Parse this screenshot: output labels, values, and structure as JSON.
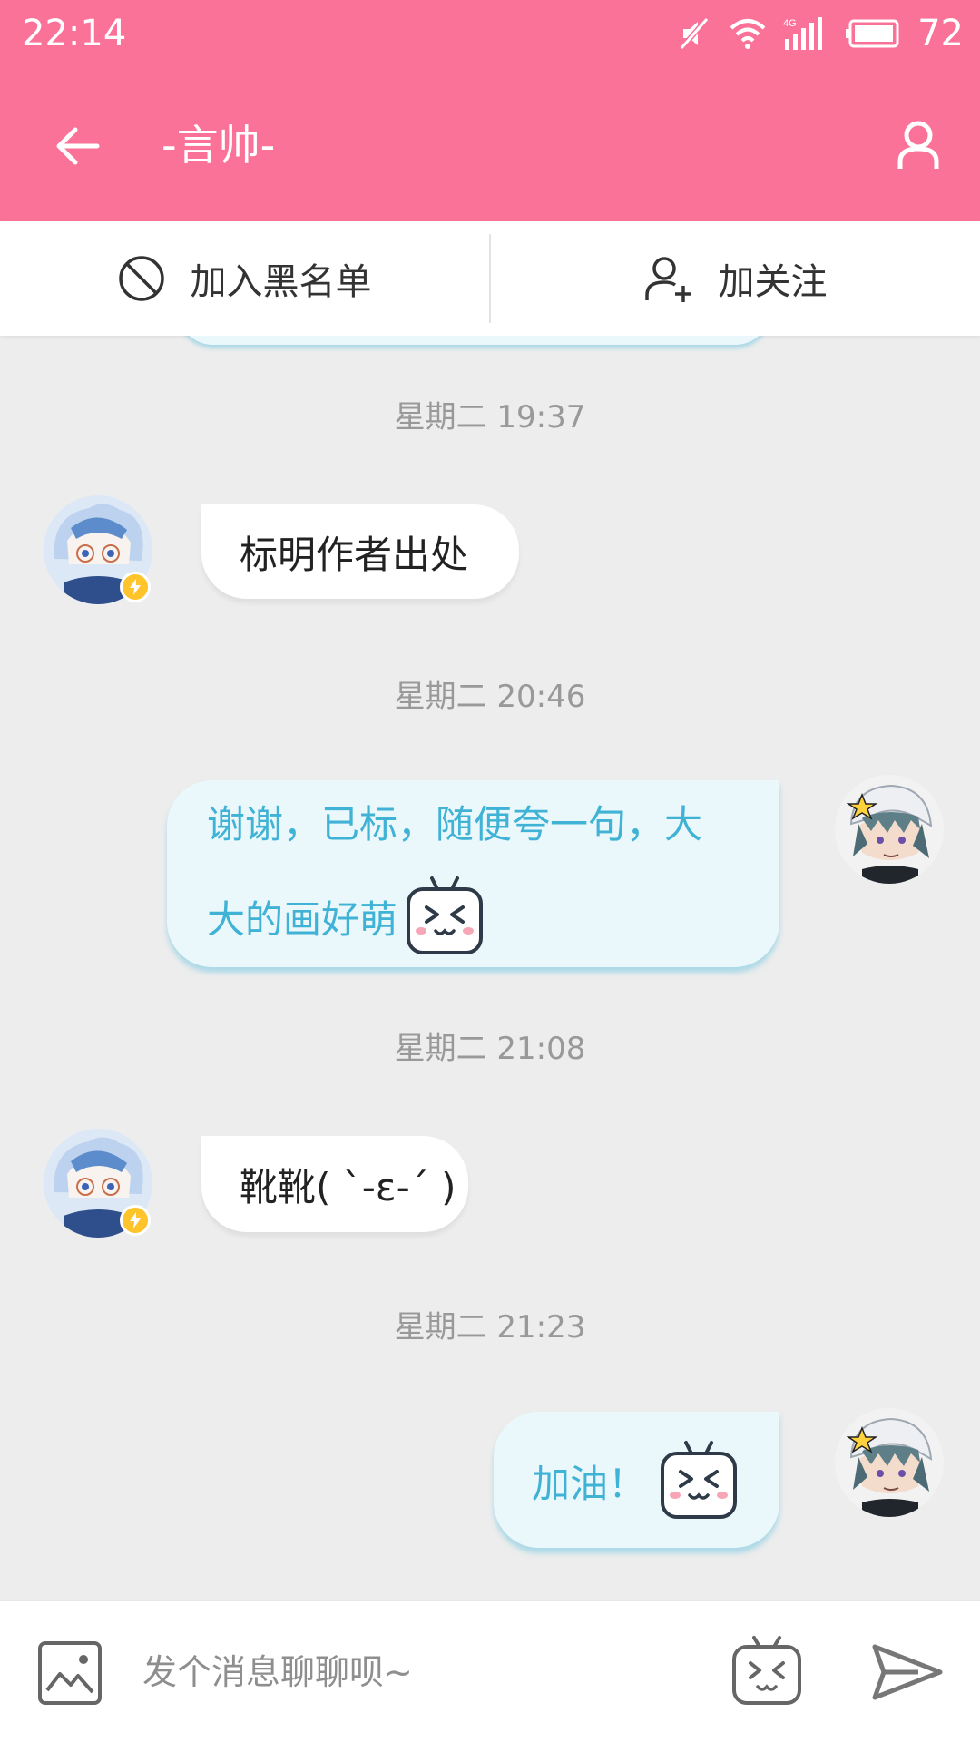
{
  "status_bar": {
    "time": "22:14",
    "network": "4G",
    "battery": "72"
  },
  "top_bar": {
    "title": "-言帅-"
  },
  "actions": {
    "blacklist": "加入黑名单",
    "follow": "加关注"
  },
  "messages": [
    {
      "timestamp": "星期二 19:37",
      "direction": "incoming",
      "text": "标明作者出处"
    },
    {
      "timestamp": "星期二 20:46",
      "direction": "outgoing",
      "lines": [
        "谢谢，已标，随便夸一句，大",
        "大的画好萌"
      ],
      "emoji": "tv-emoji"
    },
    {
      "timestamp": "星期二 21:08",
      "direction": "incoming",
      "text": "靴靴( ˋ-ε-ˊ )"
    },
    {
      "timestamp": "星期二 21:23",
      "direction": "outgoing",
      "text": "加油！",
      "emoji": "tv-emoji"
    }
  ],
  "input": {
    "placeholder": "发个消息聊聊呗~"
  },
  "colors": {
    "brand_pink": "#FB7299",
    "outgoing_bubble": "#EAF8FC",
    "outgoing_text": "#3FB2D5",
    "timestamp": "#999999",
    "badge": "#FFC42B"
  }
}
